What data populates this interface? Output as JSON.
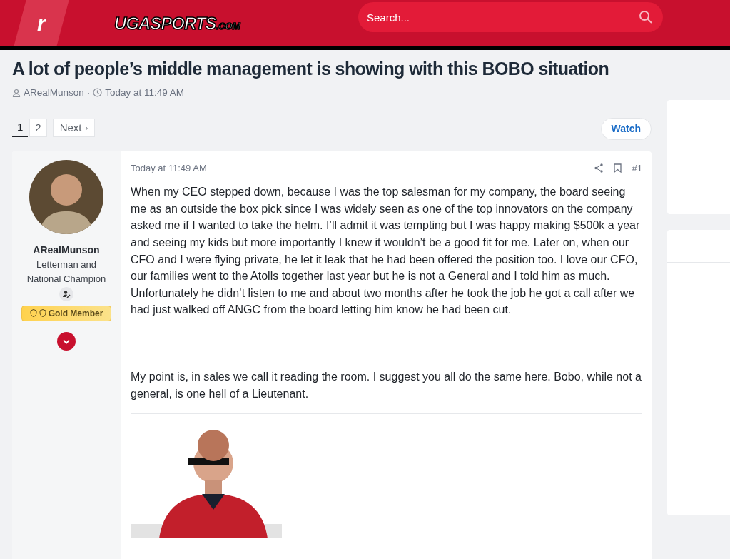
{
  "header": {
    "logo_letter": "r",
    "logo_text": "UGASPORTS",
    "logo_suffix": ".COM",
    "search": {
      "placeholder": "Search..."
    }
  },
  "thread": {
    "title": "A lot of people’s middle management is showing with this BOBO situation",
    "author": "ARealMunson",
    "separator": "·",
    "time": "Today at 11:49 AM"
  },
  "pagination": {
    "pages": [
      {
        "label": "1",
        "selected": true
      },
      {
        "label": "2",
        "selected": false
      }
    ],
    "next": "Next",
    "next_arrow": "›"
  },
  "watch_button": "Watch",
  "post": {
    "user": {
      "name": "ARealMunson",
      "title": "Letterman and National Champion",
      "badge": "Gold Member"
    },
    "time": "Today at 11:49 AM",
    "number": "#1",
    "paragraphs": [
      "When my CEO stepped down, because I was the top salesman for my company, the board seeing me as an outside the box pick since I was widely seen as one of the top innovators on the company asked me if I wanted to take the helm. I’ll admit it was tempting but I was happy making $500k a year and seeing my kids but more importantly I knew it wouldn’t be a good fit for me. Later on, when our CFO and I were flying private, he let it leak that he had been offered the position too. I love our CFO, our families went to the Atolls together last year but he is not a General and I told him as much. Unfortunately he didn’t listen to me and about two months after he took the job he got a call after we had just walked off ANGC from the board letting him know he had been cut.",
      "My point is, in sales we call it reading the room. I suggest you all do the same here. Bobo, while not a general, is one hell of a Lieutenant."
    ]
  }
}
